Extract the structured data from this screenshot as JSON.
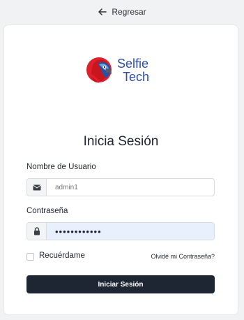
{
  "back": {
    "label": "Regresar"
  },
  "brand": {
    "line1": "Selfie",
    "line2": "Tech"
  },
  "form": {
    "title": "Inicia Sesión",
    "username": {
      "label": "Nombre de Usuario",
      "placeholder": "admin1"
    },
    "password": {
      "label": "Contraseña",
      "value": "••••••••••••"
    },
    "remember_label": "Recuérdame",
    "forgot_label": "Olvidé mi Contraseña?",
    "submit_label": "Iniciar Sesión"
  },
  "icons": {
    "back": "arrow-left-icon",
    "username": "envelope-icon",
    "password": "lock-icon"
  },
  "colors": {
    "brand": "#e01f2d",
    "button": "#1e2533",
    "autofill": "#e8f0fe",
    "background": "#f1f2f4"
  }
}
